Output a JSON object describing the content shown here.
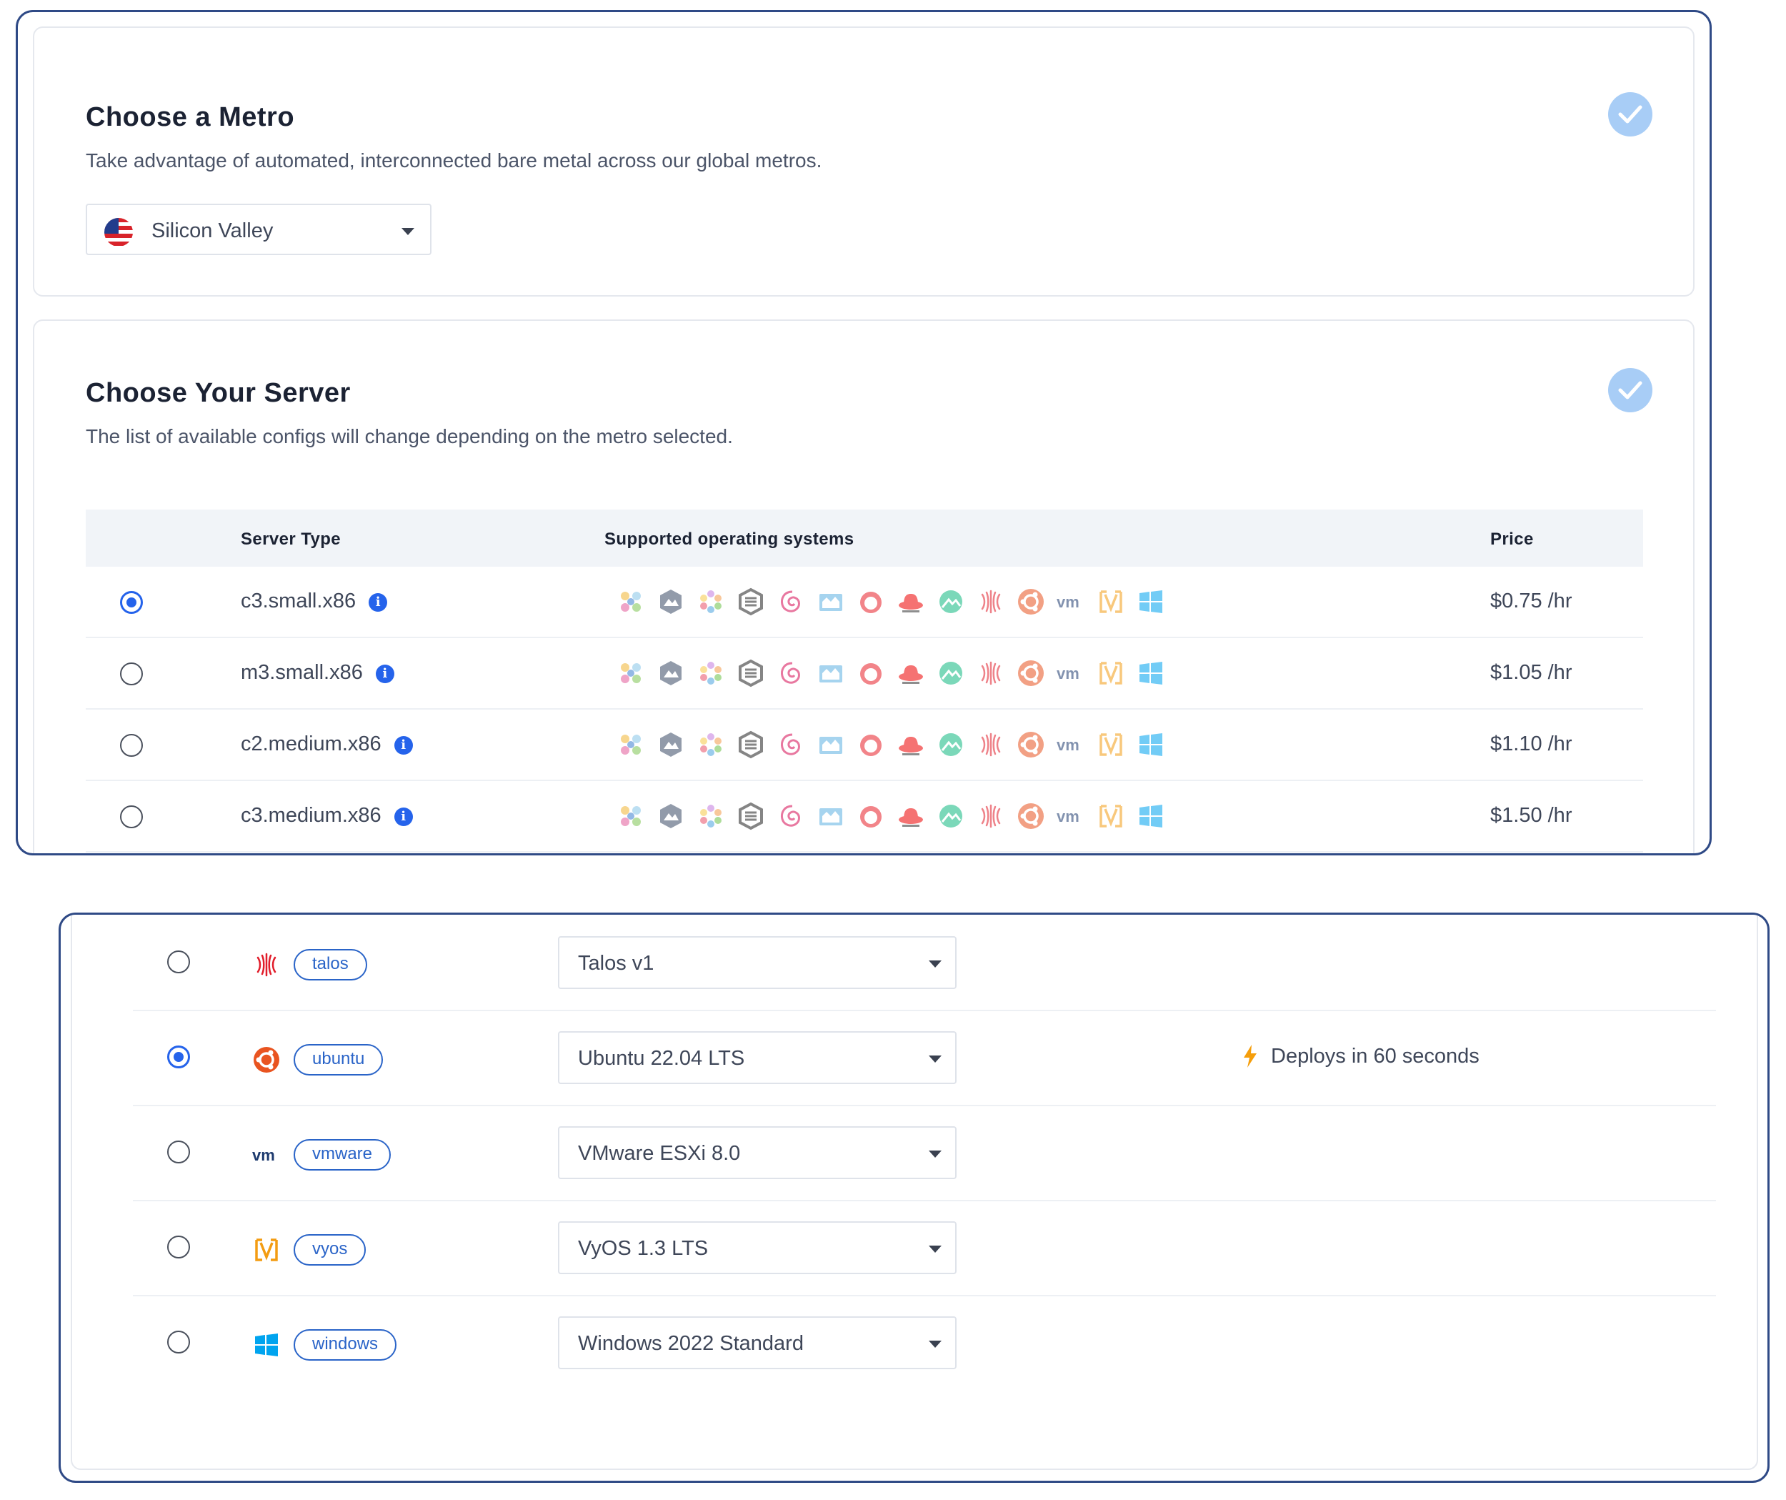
{
  "metro_section": {
    "title": "Choose a Metro",
    "subtitle": "Take advantage of automated, interconnected bare metal across our global metros.",
    "selected_metro": "Silicon Valley",
    "flag_icon": "us-flag-icon"
  },
  "server_section": {
    "title": "Choose Your Server",
    "subtitle": "The list of available configs will change depending on the metro selected.",
    "columns": {
      "server_type": "Server Type",
      "supported_os": "Supported operating systems",
      "price": "Price"
    },
    "os_icons": [
      "alma-icon",
      "flatcar-hex-icon",
      "nixos-icon",
      "opensuse-icon",
      "debian-icon",
      "flatcar-icon",
      "freebsd-icon",
      "redhat-icon",
      "rocky-icon",
      "talos-icon",
      "ubuntu-icon",
      "vmware-icon",
      "vyos-icon",
      "windows-icon"
    ],
    "servers": [
      {
        "name": "c3.small.x86",
        "price": "$0.75 /hr",
        "selected": true
      },
      {
        "name": "m3.small.x86",
        "price": "$1.05 /hr",
        "selected": false
      },
      {
        "name": "c2.medium.x86",
        "price": "$1.10 /hr",
        "selected": false
      },
      {
        "name": "c3.medium.x86",
        "price": "$1.50 /hr",
        "selected": false
      }
    ]
  },
  "os_section": {
    "rows": [
      {
        "tag": "talos",
        "icon": "talos-icon",
        "version": "Talos v1",
        "selected": false,
        "note": ""
      },
      {
        "tag": "ubuntu",
        "icon": "ubuntu-icon",
        "version": "Ubuntu 22.04 LTS",
        "selected": true,
        "note": "Deploys in 60 seconds"
      },
      {
        "tag": "vmware",
        "icon": "vmware-icon",
        "version": "VMware ESXi 8.0",
        "selected": false,
        "note": ""
      },
      {
        "tag": "vyos",
        "icon": "vyos-icon",
        "version": "VyOS 1.3 LTS",
        "selected": false,
        "note": ""
      },
      {
        "tag": "windows",
        "icon": "windows-icon",
        "version": "Windows 2022 Standard",
        "selected": false,
        "note": ""
      }
    ]
  },
  "colors": {
    "accent": "#2563eb",
    "check_badge": "#a8cdf6",
    "frame": "#2f4a86",
    "tag": "#2a64c8",
    "deploy_bolt": "#f59e0b"
  }
}
